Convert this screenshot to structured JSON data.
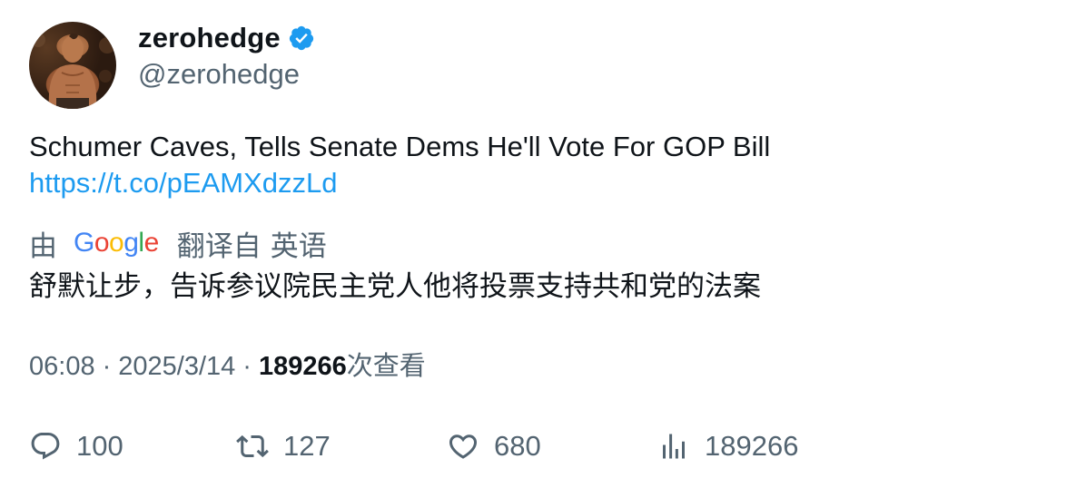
{
  "author": {
    "display_name": "zerohedge",
    "handle": "@zerohedge",
    "verified_color": "#1d9bf0"
  },
  "tweet": {
    "text": "Schumer Caves, Tells Senate Dems He'll Vote For GOP Bill",
    "link": "https://t.co/pEAMXdzzLd"
  },
  "translation": {
    "by_label": "由",
    "provider": "Google",
    "from_label": "翻译自",
    "language": "英语",
    "translated_text": "舒默让步，告诉参议院民主党人他将投票支持共和党的法案"
  },
  "meta": {
    "time": "06:08",
    "date": "2025/3/14",
    "views_count": "189266",
    "views_label": "次查看"
  },
  "actions": {
    "replies": "100",
    "retweets": "127",
    "likes": "680",
    "views": "189266"
  },
  "colors": {
    "text": "#0f1419",
    "secondary": "#536471",
    "link": "#1d9bf0"
  }
}
